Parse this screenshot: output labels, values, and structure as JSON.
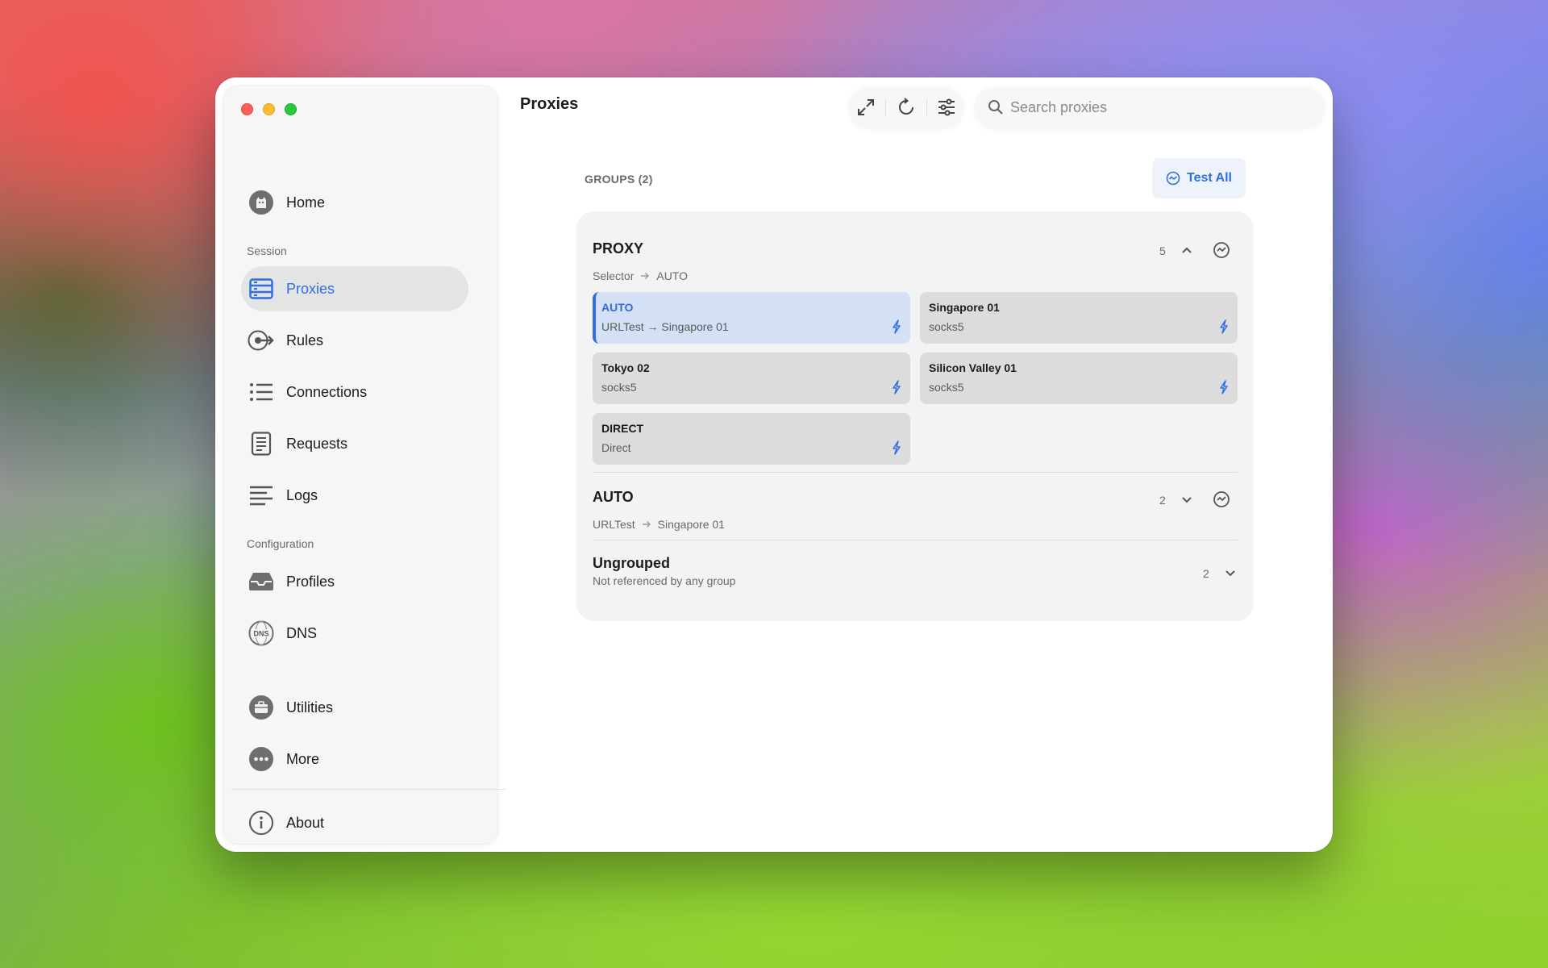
{
  "page": {
    "title": "Proxies"
  },
  "sidebar": {
    "items": [
      {
        "id": "home",
        "label": "Home",
        "icon": "cat-avatar-icon"
      },
      {
        "id": "proxies",
        "label": "Proxies",
        "icon": "server-stack-icon",
        "active": true
      },
      {
        "id": "rules",
        "label": "Rules",
        "icon": "route-arrow-icon"
      },
      {
        "id": "connections",
        "label": "Connections",
        "icon": "list-icon"
      },
      {
        "id": "requests",
        "label": "Requests",
        "icon": "document-icon"
      },
      {
        "id": "logs",
        "label": "Logs",
        "icon": "lines-icon"
      },
      {
        "id": "profiles",
        "label": "Profiles",
        "icon": "inbox-icon"
      },
      {
        "id": "dns",
        "label": "DNS",
        "icon": "dns-icon"
      },
      {
        "id": "utilities",
        "label": "Utilities",
        "icon": "toolbox-icon"
      },
      {
        "id": "more",
        "label": "More",
        "icon": "ellipsis-icon"
      },
      {
        "id": "about",
        "label": "About",
        "icon": "info-icon"
      }
    ],
    "sections": {
      "session": "Session",
      "configuration": "Configuration"
    }
  },
  "toolbar": {
    "icons": [
      "expand-icon",
      "refresh-icon",
      "sliders-icon"
    ]
  },
  "search": {
    "placeholder": "Search proxies",
    "value": ""
  },
  "groups": {
    "label": "GROUPS (2)",
    "test_all_label": "Test All",
    "proxy": {
      "name": "PROXY",
      "type": "Selector",
      "current": "AUTO",
      "count": "5",
      "expanded": true,
      "members": [
        {
          "name": "AUTO",
          "type": "URLTest → Singapore 01",
          "selected": true
        },
        {
          "name": "Singapore 01",
          "type": "socks5"
        },
        {
          "name": "Tokyo 02",
          "type": "socks5"
        },
        {
          "name": "Silicon Valley 01",
          "type": "socks5"
        },
        {
          "name": "DIRECT",
          "type": "Direct"
        }
      ]
    },
    "auto": {
      "name": "AUTO",
      "type": "URLTest",
      "current": "Singapore 01",
      "count": "2",
      "expanded": false
    },
    "ungrouped": {
      "name": "Ungrouped",
      "subtitle": "Not referenced by any group",
      "count": "2",
      "expanded": false
    }
  },
  "colors": {
    "accent": "#2f6fe0",
    "selected_card": "#d3e0f5",
    "card": "#dcdcdc"
  }
}
